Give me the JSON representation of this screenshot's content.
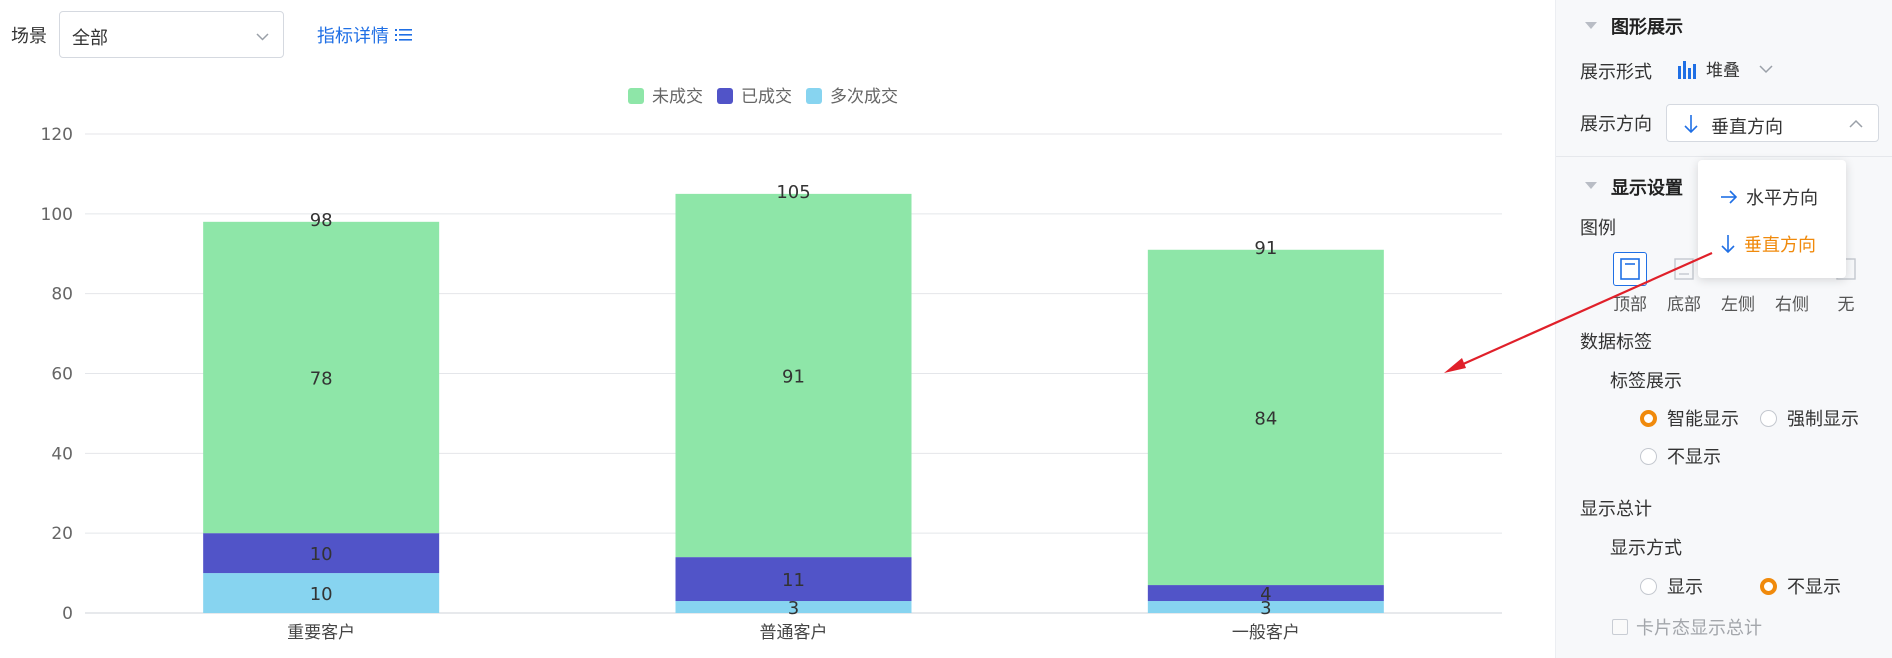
{
  "toolbar": {
    "scene_label": "场景",
    "scene_value": "全部",
    "metric_link": "指标详情"
  },
  "chart_data": {
    "type": "bar",
    "stacked": true,
    "categories": [
      "重要客户",
      "普通客户",
      "一般客户"
    ],
    "series": [
      {
        "name": "未成交",
        "color": "#8ee6a8",
        "values": [
          78,
          91,
          84
        ]
      },
      {
        "name": "已成交",
        "color": "#5154c8",
        "values": [
          10,
          11,
          4
        ]
      },
      {
        "name": "多次成交",
        "color": "#87d4f0",
        "values": [
          10,
          3,
          3
        ]
      }
    ],
    "totals": [
      98,
      105,
      91
    ],
    "ylim": [
      0,
      120
    ],
    "yticks": [
      0,
      20,
      40,
      60,
      80,
      100,
      120
    ],
    "grid": true,
    "legend_position": "top"
  },
  "panel": {
    "graphic_section": "图形展示",
    "style_label": "展示形式",
    "style_value": "堆叠",
    "direction_label": "展示方向",
    "direction_value": "垂直方向",
    "display_section": "显示设置",
    "legend_label": "图例",
    "legend_options": [
      "顶部",
      "底部",
      "左侧",
      "右侧",
      "无"
    ],
    "data_label_title": "数据标签",
    "label_display_title": "标签展示",
    "label_opts": [
      "智能显示",
      "强制显示",
      "不显示"
    ],
    "total_title": "显示总计",
    "total_mode_title": "显示方式",
    "total_opts": [
      "显示",
      "不显示"
    ],
    "card_total": "卡片态显示总计"
  },
  "popup": {
    "options": [
      "水平方向",
      "垂直方向"
    ],
    "selected": "垂直方向"
  },
  "colors": {
    "accent_blue": "#1f6fe5",
    "accent_orange": "#f08a0c",
    "annotation_red": "#e0202a"
  }
}
